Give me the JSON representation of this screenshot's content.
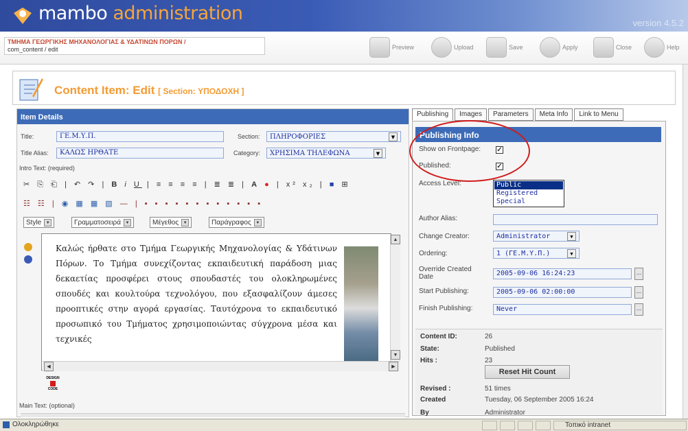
{
  "banner": {
    "title_part1": "mambo ",
    "title_part2": "administration",
    "version": "version 4.5.2"
  },
  "breadcrumb": {
    "section": "ΤΜΗΜΑ ΓΕΩΡΓΙΚΗΣ ΜΗΧΑΝΟΛΟΓΙΑΣ & ΥΔΑΤΙΝΩΝ ΠΟΡΩΝ /",
    "path": "com_content / edit"
  },
  "toolbar": {
    "preview": "Preview",
    "upload": "Upload",
    "save": "Save",
    "apply": "Apply",
    "close": "Close",
    "help": "Help"
  },
  "page": {
    "title": "Content Item: Edit",
    "section": "[ Section: ΥΠΟΔΟΧΗ ]"
  },
  "item_details": {
    "header": "Item Details",
    "title_label": "Title:",
    "title_value": "ΓΕ.Μ.Υ.Π.",
    "section_label": "Section:",
    "section_value": "ΠΛΗΡΟΦΟΡΙΕΣ",
    "alias_label": "Title Alias:",
    "alias_value": "ΚΑΛΩΣ ΗΡΘΑΤΕ",
    "category_label": "Category:",
    "category_value": "ΧΡΗΣΙΜΑ ΤΗΛΕΦΩΝΑ",
    "intro_label": "Intro Text: (required)",
    "main_label": "Main Text: (optional)"
  },
  "editor": {
    "style": "Style",
    "font": "Γραμματοσειρά",
    "size": "Μέγεθος",
    "format": "Παράγραφος",
    "text": "Καλώς ήρθατε στο Τμήμα Γεωργικής Μηχανολογίας & Υδάτινων Πόρων. Το Τμήμα συνεχίζοντας εκπαιδευτική παράδοση μιας δεκαετίας προσφέρει στους σπουδαστές του ολοκληρωμένες σπουδές και κουλτούρα τεχνολόγου, που εξασφαλίζουν άμεσες προοπτικές στην αγορά εργασίας. Ταυτόχρονα το εκπαιδευτικό προσωπικό του Τμήματος χρησιμοποιώντας σύγχρονα μέσα και τεχνικές",
    "design_label": "DESIGN",
    "code_label": "CODE"
  },
  "tabs": [
    "Publishing",
    "Images",
    "Parameters",
    "Meta Info",
    "Link to Menu"
  ],
  "publishing": {
    "header": "Publishing Info",
    "frontpage_label": "Show on Frontpage:",
    "frontpage_checked": true,
    "published_label": "Published:",
    "published_checked": true,
    "access_label": "Access Level:",
    "access_options": [
      "Public",
      "Registered",
      "Special"
    ],
    "access_selected": "Public",
    "author_alias_label": "Author Alias:",
    "author_alias_value": "",
    "creator_label": "Change Creator:",
    "creator_value": "Administrator",
    "ordering_label": "Ordering:",
    "ordering_value": "1 (ΓΕ.Μ.Υ.Π.)",
    "override_label": "Override Created Date",
    "override_value": "2005-09-06 16:24:23",
    "start_label": "Start Publishing:",
    "start_value": "2005-09-06 02:00:00",
    "finish_label": "Finish Publishing:",
    "finish_value": "Never",
    "dots": "..."
  },
  "content_info": {
    "id_label": "Content ID:",
    "id_value": "26",
    "state_label": "State:",
    "state_value": "Published",
    "hits_label": "Hits :",
    "hits_value": "23",
    "reset_label": "Reset Hit Count",
    "revised_label": "Revised :",
    "revised_value": "51 times",
    "created_label": "Created",
    "created_value": "Tuesday, 06 September 2005 16:24",
    "by_label": "By",
    "by_value": "Administrator"
  },
  "statusbar": {
    "left": "Ολοκληρώθηκε",
    "zone": "Τοπικό intranet"
  },
  "colors": {
    "banner": "#3a5bb5",
    "accent_orange": "#f39b33",
    "header_blue": "#3d6bb7",
    "field_text": "#1b2e9f",
    "annotation_red": "#d21b1b"
  }
}
